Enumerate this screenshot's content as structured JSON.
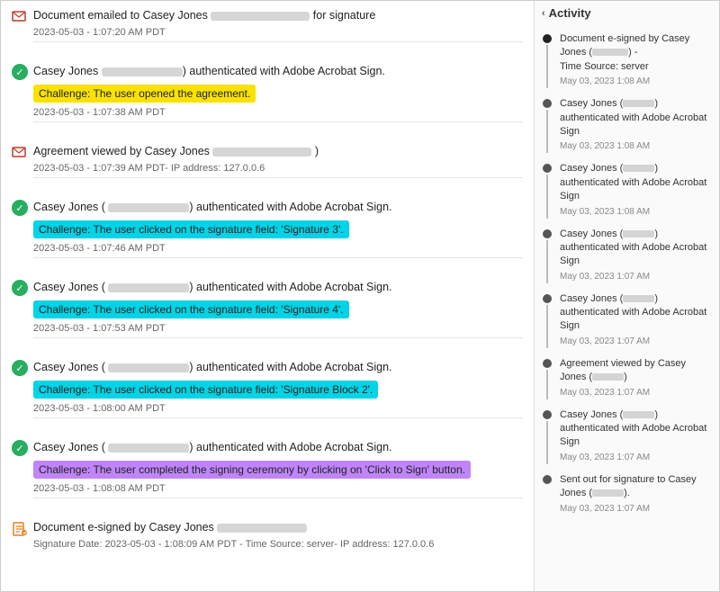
{
  "left": {
    "events": [
      {
        "id": "email",
        "icon": "email",
        "title_pre": "Document emailed to Casey Jones",
        "blurred_width": 110,
        "title_post": "for signature",
        "date": "2023-05-03 - 1:07:20 AM PDT",
        "challenge": null
      },
      {
        "id": "auth1",
        "icon": "check",
        "title_pre": "Casey Jones",
        "blurred_width": 90,
        "title_post": ") authenticated with Adobe Acrobat Sign.",
        "date": "2023-05-03 - 1:07:38 AM PDT",
        "challenge": {
          "text": "Challenge: The user opened the agreement.",
          "color": "yellow"
        }
      },
      {
        "id": "view",
        "icon": "email",
        "title_pre": "Agreement viewed by Casey Jones",
        "blurred_width": 110,
        "title_post": ")",
        "date": "2023-05-03 - 1:07:39 AM PDT- IP address: 127.0.0.6",
        "challenge": null
      },
      {
        "id": "auth2",
        "icon": "check",
        "title_pre": "Casey Jones (",
        "blurred_width": 90,
        "title_post": ") authenticated with Adobe Acrobat Sign.",
        "date": "2023-05-03 - 1:07:46 AM PDT",
        "challenge": {
          "text": "Challenge: The user clicked on the signature field: 'Signature 3'.",
          "color": "cyan"
        }
      },
      {
        "id": "auth3",
        "icon": "check",
        "title_pre": "Casey Jones (",
        "blurred_width": 90,
        "title_post": ") authenticated with Adobe Acrobat Sign.",
        "date": "2023-05-03 - 1:07:53 AM PDT",
        "challenge": {
          "text": "Challenge: The user clicked on the signature field: 'Signature 4'.",
          "color": "cyan"
        }
      },
      {
        "id": "auth4",
        "icon": "check",
        "title_pre": "Casey Jones (",
        "blurred_width": 90,
        "title_post": ") authenticated with Adobe Acrobat Sign.",
        "date": "2023-05-03 - 1:08:00 AM PDT",
        "challenge": {
          "text": "Challenge: The user clicked on the signature field: 'Signature Block 2'.",
          "color": "cyan"
        }
      },
      {
        "id": "auth5",
        "icon": "check",
        "title_pre": "Casey Jones (",
        "blurred_width": 90,
        "title_post": ") authenticated with Adobe Acrobat Sign.",
        "date": "2023-05-03 - 1:08:08 AM PDT",
        "challenge": {
          "text": "Challenge: The user completed the signing ceremony by clicking on 'Click to Sign' button.",
          "color": "purple"
        }
      },
      {
        "id": "esign",
        "icon": "esign",
        "title_pre": "Document e-signed by Casey Jones",
        "blurred_width": 100,
        "title_post": "",
        "date": "Signature Date: 2023-05-03 - 1:08:09 AM PDT - Time Source: server- IP address: 127.0.0.6",
        "challenge": null
      }
    ]
  },
  "right": {
    "header": "Activity",
    "items": [
      {
        "dot": "filled",
        "text_pre": "Document e-signed by Casey Jones (",
        "blurred": 40,
        "text_post": ") -",
        "extra": "Time Source: server",
        "date": "May 03, 2023 1:08 AM"
      },
      {
        "dot": "normal",
        "text_pre": "Casey Jones (",
        "blurred": 35,
        "text_post": ") authenticated with Adobe Acrobat Sign",
        "extra": "",
        "date": "May 03, 2023 1:08 AM"
      },
      {
        "dot": "normal",
        "text_pre": "Casey Jones (",
        "blurred": 35,
        "text_post": ") authenticated with Adobe Acrobat Sign",
        "extra": "",
        "date": "May 03, 2023 1:08 AM"
      },
      {
        "dot": "normal",
        "text_pre": "Casey Jones (",
        "blurred": 35,
        "text_post": ") authenticated with Adobe Acrobat Sign",
        "extra": "",
        "date": "May 03, 2023 1:07 AM"
      },
      {
        "dot": "normal",
        "text_pre": "Casey Jones (",
        "blurred": 35,
        "text_post": ") authenticated with Adobe Acrobat Sign",
        "extra": "",
        "date": "May 03, 2023 1:07 AM"
      },
      {
        "dot": "normal",
        "text_pre": "Agreement viewed by Casey Jones (",
        "blurred": 35,
        "text_post": ")",
        "extra": "",
        "date": "May 03, 2023 1:07 AM"
      },
      {
        "dot": "normal",
        "text_pre": "Casey Jones (",
        "blurred": 35,
        "text_post": ") authenticated with Adobe Acrobat Sign",
        "extra": "",
        "date": "May 03, 2023 1:07 AM"
      },
      {
        "dot": "normal",
        "text_pre": "Sent out for signature to Casey Jones (",
        "blurred": 35,
        "text_post": ").",
        "extra": "",
        "date": "May 03, 2023 1:07 AM"
      }
    ]
  }
}
